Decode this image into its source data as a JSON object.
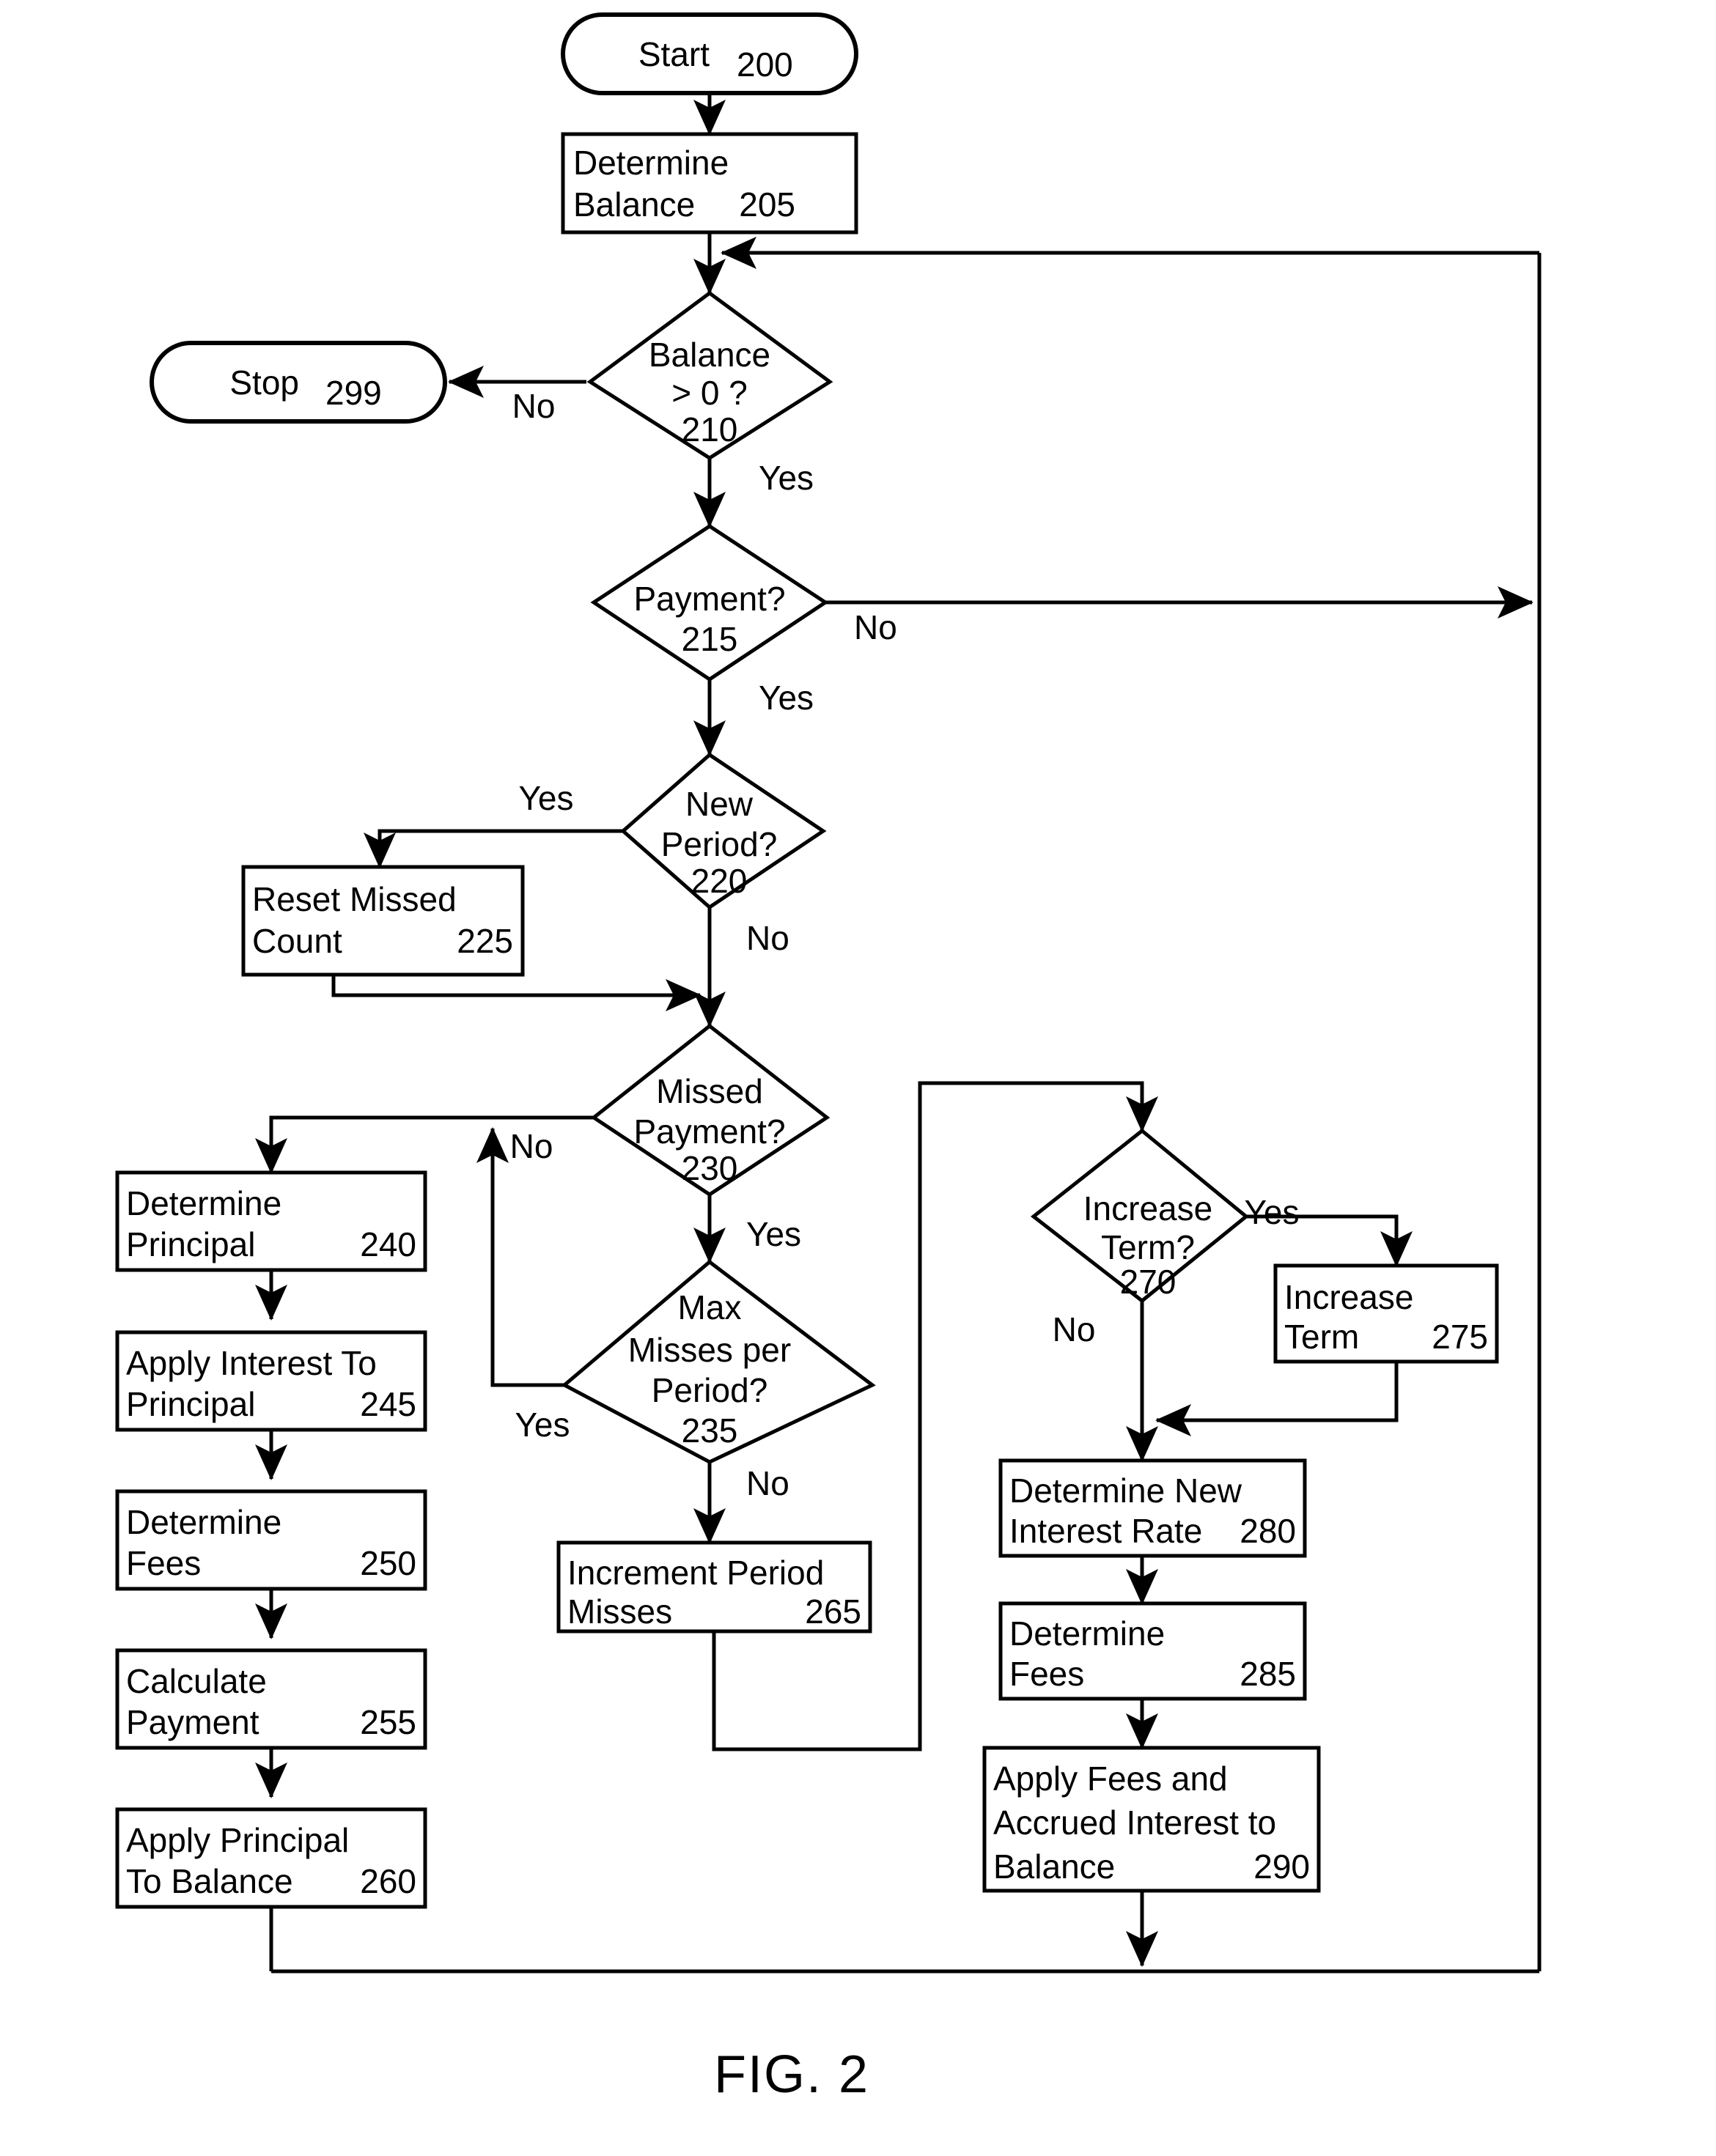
{
  "figure": {
    "label": "FIG. 2",
    "caption_ref": "FIG. 2"
  },
  "nodes": {
    "start": {
      "text": "Start",
      "ref": "200",
      "shape": "terminator"
    },
    "determine_balance": {
      "line1": "Determine",
      "line2": "Balance",
      "ref": "205",
      "shape": "process"
    },
    "balance_gt_zero": {
      "line1": "Balance",
      "line2": "> 0 ?",
      "ref": "210",
      "shape": "decision"
    },
    "stop": {
      "text": "Stop",
      "ref": "299",
      "shape": "terminator"
    },
    "payment": {
      "line1": "Payment?",
      "ref": "215",
      "shape": "decision"
    },
    "new_period": {
      "line1": "New",
      "line2": "Period?",
      "ref": "220",
      "shape": "decision"
    },
    "reset_missed_count": {
      "line1": "Reset Missed",
      "line2": "Count",
      "ref": "225",
      "shape": "process"
    },
    "missed_payment": {
      "line1": "Missed",
      "line2": "Payment?",
      "ref": "230",
      "shape": "decision"
    },
    "max_misses": {
      "line1": "Max",
      "line2": "Misses per",
      "line3": "Period?",
      "ref": "235",
      "shape": "decision"
    },
    "determine_principal": {
      "line1": "Determine",
      "line2": "Principal",
      "ref": "240",
      "shape": "process"
    },
    "apply_interest": {
      "line1": "Apply Interest To",
      "line2": "Principal",
      "ref": "245",
      "shape": "process"
    },
    "determine_fees_250": {
      "line1": "Determine",
      "line2": "Fees",
      "ref": "250",
      "shape": "process"
    },
    "calculate_payment": {
      "line1": "Calculate",
      "line2": "Payment",
      "ref": "255",
      "shape": "process"
    },
    "apply_principal": {
      "line1": "Apply Principal",
      "line2": "To Balance",
      "ref": "260",
      "shape": "process"
    },
    "increment_period_misses": {
      "line1": "Increment Period",
      "line2": "Misses",
      "ref": "265",
      "shape": "process"
    },
    "increase_term_q": {
      "line1": "Increase",
      "line2": "Term?",
      "ref": "270",
      "shape": "decision"
    },
    "increase_term": {
      "line1": "Increase",
      "line2": "Term",
      "ref": "275",
      "shape": "process"
    },
    "determine_new_rate": {
      "line1": "Determine New",
      "line2": "Interest Rate",
      "ref": "280",
      "shape": "process"
    },
    "determine_fees_285": {
      "line1": "Determine",
      "line2": "Fees",
      "ref": "285",
      "shape": "process"
    },
    "apply_fees": {
      "line1": "Apply Fees and",
      "line2": "Accrued Interest to",
      "line3": "Balance",
      "ref": "290",
      "shape": "process"
    }
  },
  "edge_labels": {
    "balance_no": "No",
    "balance_yes": "Yes",
    "payment_no": "No",
    "payment_yes": "Yes",
    "new_period_yes": "Yes",
    "new_period_no": "No",
    "missed_payment_no": "No",
    "missed_payment_yes": "Yes",
    "max_misses_yes": "Yes",
    "max_misses_no": "No",
    "increase_term_yes": "Yes",
    "increase_term_no": "No"
  },
  "colors": {
    "stroke": "#000000",
    "fill": "#ffffff",
    "text": "#000000"
  }
}
